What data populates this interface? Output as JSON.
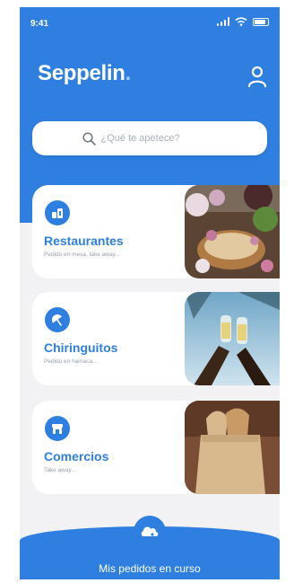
{
  "status_bar": {
    "time": "9:41"
  },
  "header": {
    "logo_text": "Seppelin",
    "logo_dot": "."
  },
  "search": {
    "placeholder": "¿Qué te apetece?"
  },
  "categories": [
    {
      "title": "Restaurantes",
      "subtitle": "Pedido en mesa, take away...",
      "icon": "restaurant-icon"
    },
    {
      "title": "Chiringuitos",
      "subtitle": "Pedido en hamaca...",
      "icon": "umbrella-icon"
    },
    {
      "title": "Comercios",
      "subtitle": "Take away...",
      "icon": "store-icon"
    }
  ],
  "bottom": {
    "label": "Mis pedidos en curso"
  },
  "colors": {
    "primary": "#2f7fe0",
    "background": "#f2f2f4",
    "card": "#ffffff",
    "muted_text": "#9aa0a8"
  }
}
